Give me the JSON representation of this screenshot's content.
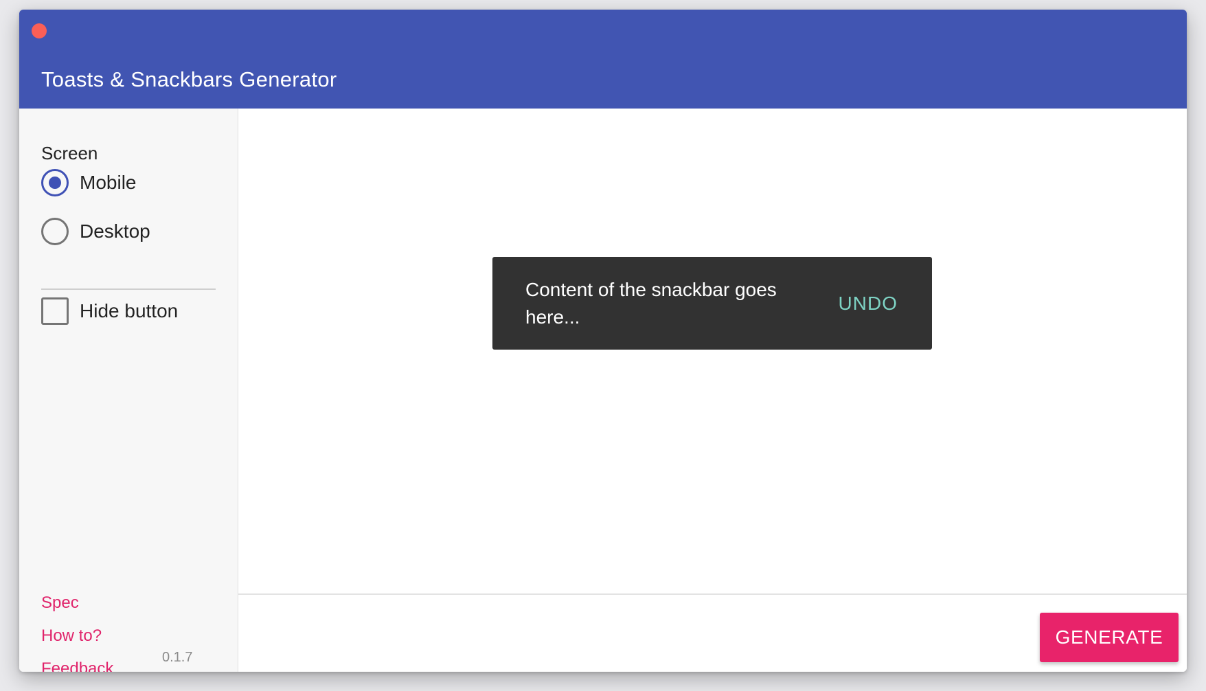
{
  "window": {
    "title": "Toasts & Snackbars Generator"
  },
  "sidebar": {
    "screen_label": "Screen",
    "screen_options": [
      {
        "label": "Mobile",
        "selected": true
      },
      {
        "label": "Desktop",
        "selected": false
      }
    ],
    "hide_button": {
      "label": "Hide button",
      "checked": false
    },
    "links": [
      "Spec",
      "How to?",
      "Feedback"
    ],
    "version": "0.1.7"
  },
  "preview": {
    "snackbar_text": "Content of the snackbar goes here...",
    "snackbar_action": "UNDO"
  },
  "footer": {
    "generate_label": "GENERATE"
  },
  "colors": {
    "header": "#4155b2",
    "accent": "#e8236a",
    "radio_selected": "#3f51b5",
    "snackbar_bg": "#323232",
    "snackbar_action": "#7ed3c4",
    "close_button": "#fa5f57"
  }
}
